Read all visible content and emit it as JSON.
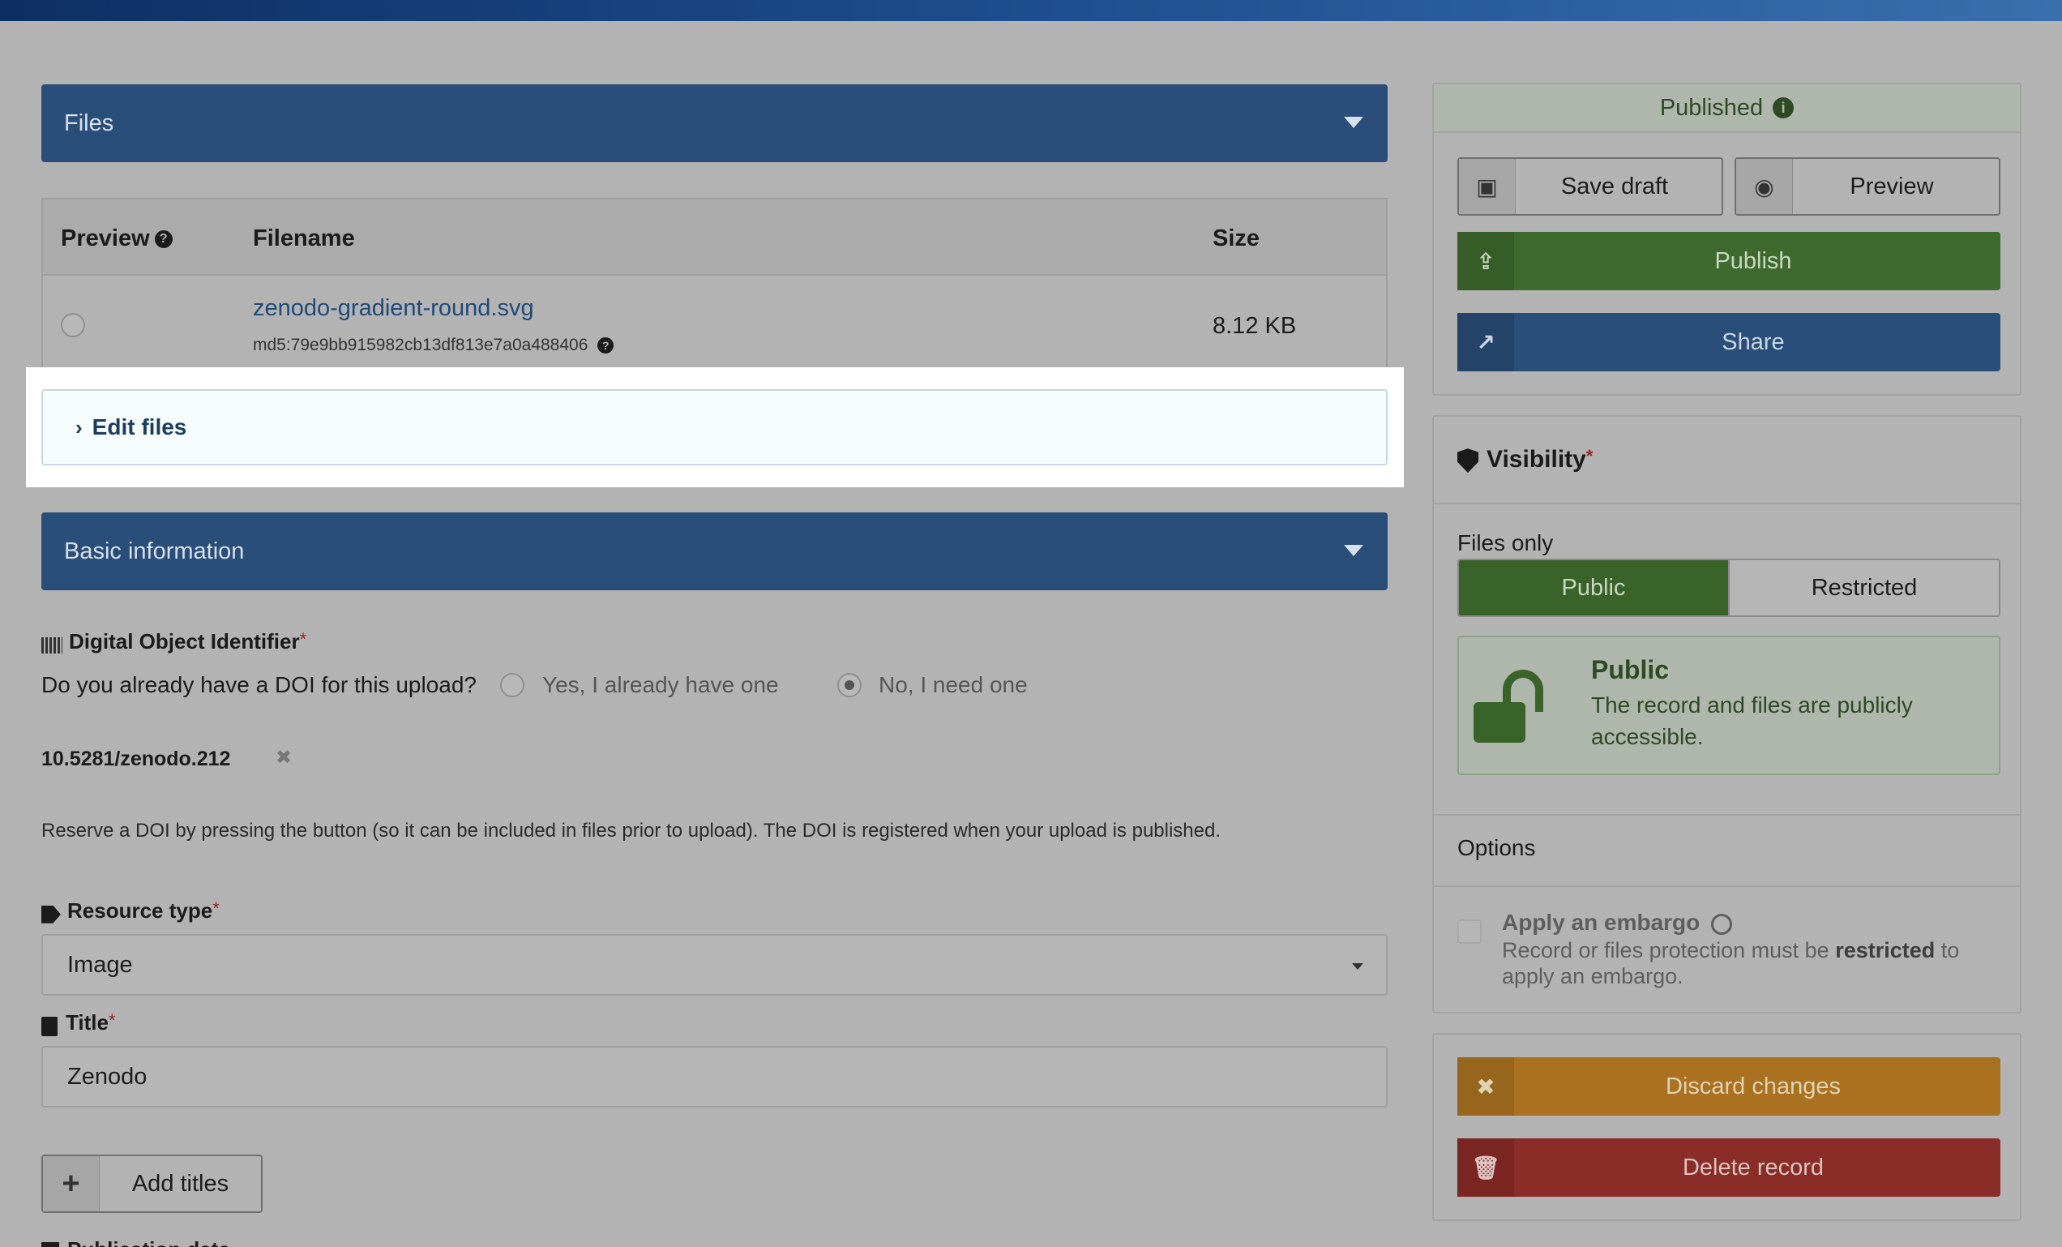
{
  "files_section": {
    "header": "Files",
    "columns": {
      "preview": "Preview",
      "filename": "Filename",
      "size": "Size"
    },
    "rows": [
      {
        "filename": "zenodo-gradient-round.svg",
        "checksum": "md5:79e9bb915982cb13df813e7a0a488406",
        "size": "8.12 KB"
      }
    ],
    "edit_files": "Edit files"
  },
  "basic_info": {
    "header": "Basic information",
    "doi": {
      "label": "Digital Object Identifier",
      "question": "Do you already have a DOI for this upload?",
      "option_yes": "Yes, I already have one",
      "option_no": "No, I need one",
      "selected": "no",
      "value": "10.5281/zenodo.212",
      "help": "Reserve a DOI by pressing the button (so it can be included in files prior to upload). The DOI is registered when your upload is published."
    },
    "resource_type": {
      "label": "Resource type",
      "value": "Image"
    },
    "title": {
      "label": "Title",
      "value": "Zenodo"
    },
    "add_titles": "Add titles",
    "next_label": "Publication date"
  },
  "sidebar": {
    "status": "Published",
    "save_draft": "Save draft",
    "preview": "Preview",
    "publish": "Publish",
    "share": "Share",
    "visibility": {
      "title": "Visibility",
      "files_only": "Files only",
      "public": "Public",
      "restricted": "Restricted",
      "public_title": "Public",
      "public_desc": "The record and files are publicly accessible.",
      "options": "Options",
      "embargo_title": "Apply an embargo",
      "embargo_desc_1": "Record or files protection must be ",
      "embargo_desc_bold": "restricted",
      "embargo_desc_2": " to apply an embargo."
    },
    "discard": "Discard changes",
    "delete": "Delete record"
  },
  "colors": {
    "primary": "#2a4e7a",
    "success": "#3f6a2e",
    "warning": "#a97120",
    "danger": "#8a2c28",
    "required": "#9a2424"
  }
}
